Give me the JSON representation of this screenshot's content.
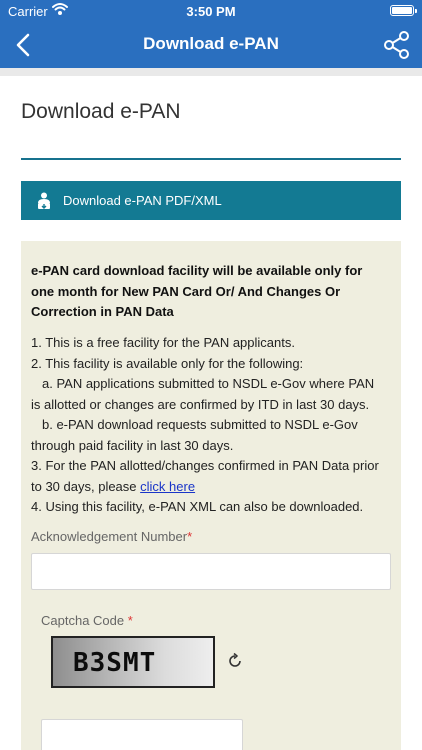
{
  "status_bar": {
    "carrier": "Carrier",
    "time": "3:50 PM"
  },
  "nav": {
    "title": "Download e-PAN"
  },
  "page": {
    "heading": "Download e-PAN"
  },
  "download_bar": {
    "label": "Download e-PAN PDF/XML"
  },
  "notice": {
    "bold": "e-PAN card download facility will be available only for one month for New PAN Card Or/ And Changes Or Correction in PAN Data",
    "lines": [
      "1. This is a free facility for the PAN applicants.",
      "2. This facility is available only for the following:",
      "a. PAN applications submitted to NSDL e-Gov where PAN",
      "is allotted or changes are confirmed by ITD in last 30 days.",
      "b. e-PAN download requests submitted to NSDL e-Gov",
      "through paid facility in last 30 days.",
      "3. For the PAN allotted/changes confirmed in PAN Data prior",
      "to 30 days, please",
      "4. Using this facility, e-PAN XML can also be downloaded."
    ],
    "link": "click here"
  },
  "form": {
    "ack_label": "Acknowledgement Number",
    "required_mark": "*",
    "ack_value": "",
    "captcha_label": "Captcha Code",
    "captcha_text": "B3SMT",
    "captcha_value": ""
  },
  "colors": {
    "nav_blue": "#2a6fbf",
    "teal": "#137a93",
    "notice_bg": "#efeedf",
    "link": "#1a35c8"
  },
  "icons": {
    "back": "chevron-left-icon",
    "share": "share-icon",
    "download": "person-download-icon",
    "refresh": "refresh-icon",
    "wifi": "wifi-icon",
    "battery": "battery-icon"
  }
}
